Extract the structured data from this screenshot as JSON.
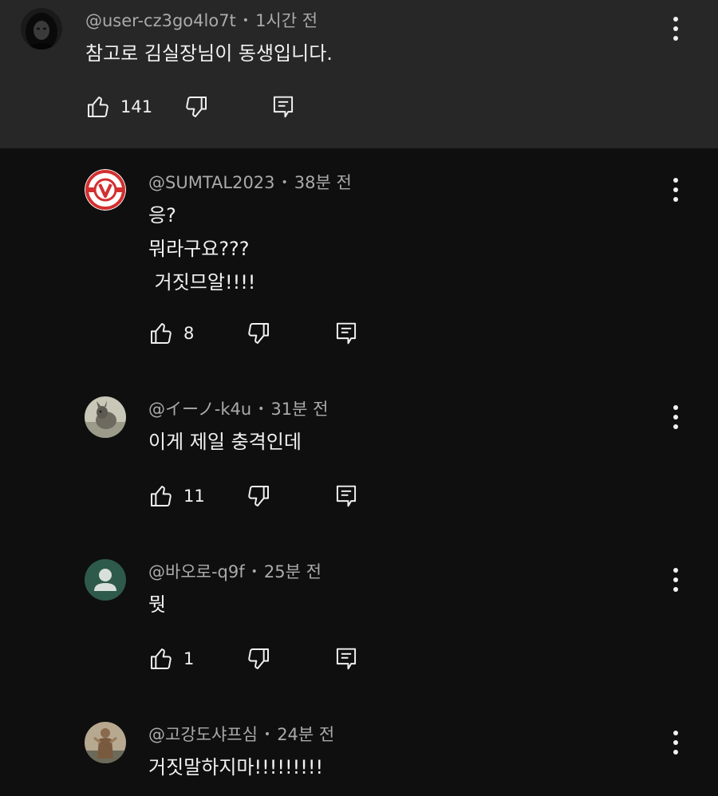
{
  "comments": [
    {
      "author": "@user-cz3go4lo7t",
      "time": "1시간 전",
      "text": "참고로 김실장님이 동생입니다.",
      "likes": "141",
      "avatar": "hooded-figure"
    },
    {
      "author": "@SUMTAL2023",
      "time": "38분 전",
      "text": "응?\n뭐라구요???\n 거짓므알!!!!",
      "likes": "8",
      "avatar": "red-v-logo"
    },
    {
      "author": "@イーノ-k4u",
      "time": "31분 전",
      "text": "이게 제일 충격인데",
      "likes": "11",
      "avatar": "animal-photo"
    },
    {
      "author": "@바오로-q9f",
      "time": "25분 전",
      "text": "뭣",
      "likes": "1",
      "avatar": "default-person"
    },
    {
      "author": "@고강도샤프심",
      "time": "24분 전",
      "text": "거짓말하지마!!!!!!!!!",
      "likes": "",
      "avatar": "statue-photo"
    }
  ],
  "separator": "•",
  "colors": {
    "background": "#0f0f0f",
    "parent_background": "#272727",
    "meta_text": "#aaaaaa",
    "primary_text": "#f1f1f1"
  }
}
